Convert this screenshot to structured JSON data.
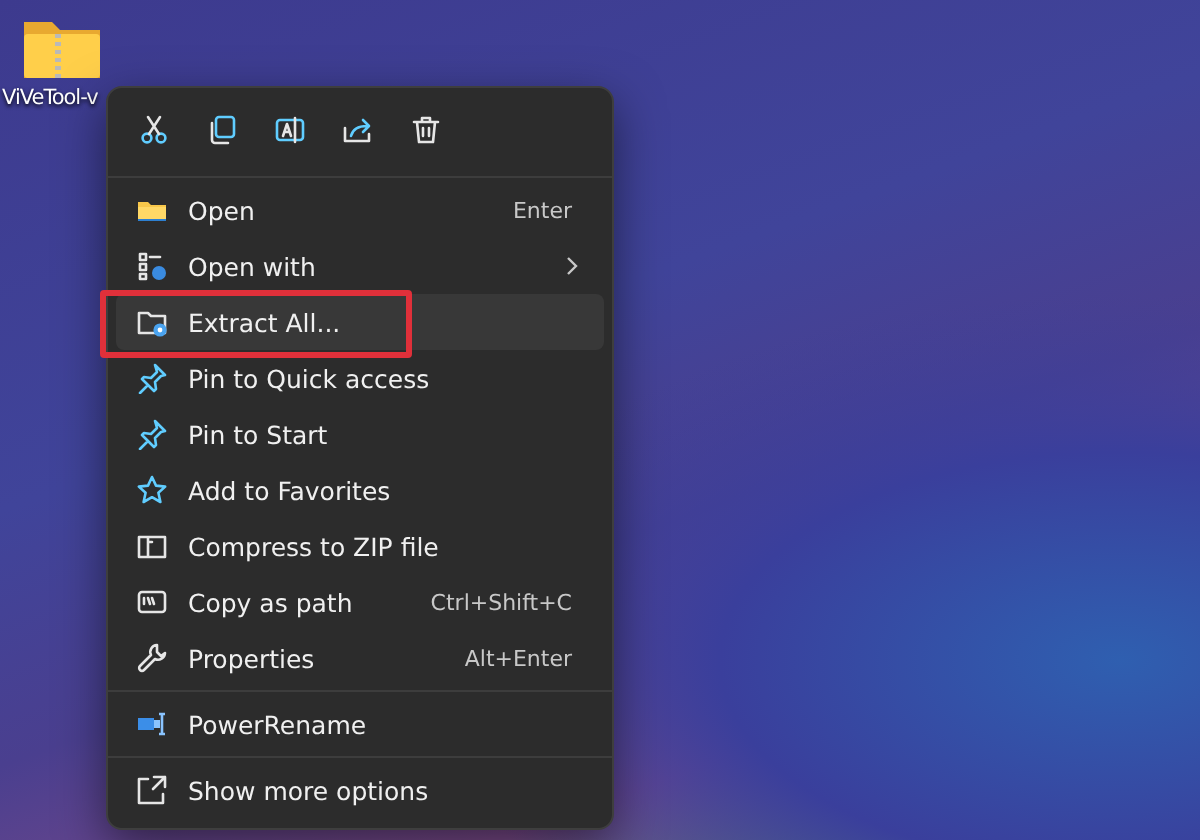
{
  "desktop_icon": {
    "label": "ViVeTool-v"
  },
  "context_menu": {
    "sections": [
      {
        "items": [
          {
            "kind": "folder",
            "label": "Open",
            "shortcut": "Enter",
            "submenu": false,
            "selected": false,
            "outlined": false
          },
          {
            "kind": "openwith",
            "label": "Open with",
            "submenu": true,
            "selected": false,
            "outlined": false
          },
          {
            "kind": "extract",
            "label": "Extract All...",
            "submenu": false,
            "selected": true,
            "outlined": true
          },
          {
            "kind": "pin",
            "label": "Pin to Quick access",
            "submenu": false,
            "selected": false,
            "outlined": false
          },
          {
            "kind": "pin",
            "label": "Pin to Start",
            "submenu": false,
            "selected": false,
            "outlined": false
          },
          {
            "kind": "star",
            "label": "Add to Favorites",
            "submenu": false,
            "selected": false,
            "outlined": false
          },
          {
            "kind": "zip",
            "label": "Compress to ZIP file",
            "submenu": false,
            "selected": false,
            "outlined": false
          },
          {
            "kind": "path",
            "label": "Copy as path",
            "shortcut": "Ctrl+Shift+C",
            "submenu": false,
            "selected": false,
            "outlined": false
          },
          {
            "kind": "wrench",
            "label": "Properties",
            "shortcut": "Alt+Enter",
            "submenu": false,
            "selected": false,
            "outlined": false
          }
        ]
      },
      {
        "items": [
          {
            "kind": "rename",
            "label": "PowerRename",
            "submenu": false,
            "selected": false,
            "outlined": false
          }
        ]
      },
      {
        "items": [
          {
            "kind": "more",
            "label": "Show more options",
            "submenu": false,
            "selected": false,
            "outlined": false
          }
        ]
      }
    ]
  }
}
